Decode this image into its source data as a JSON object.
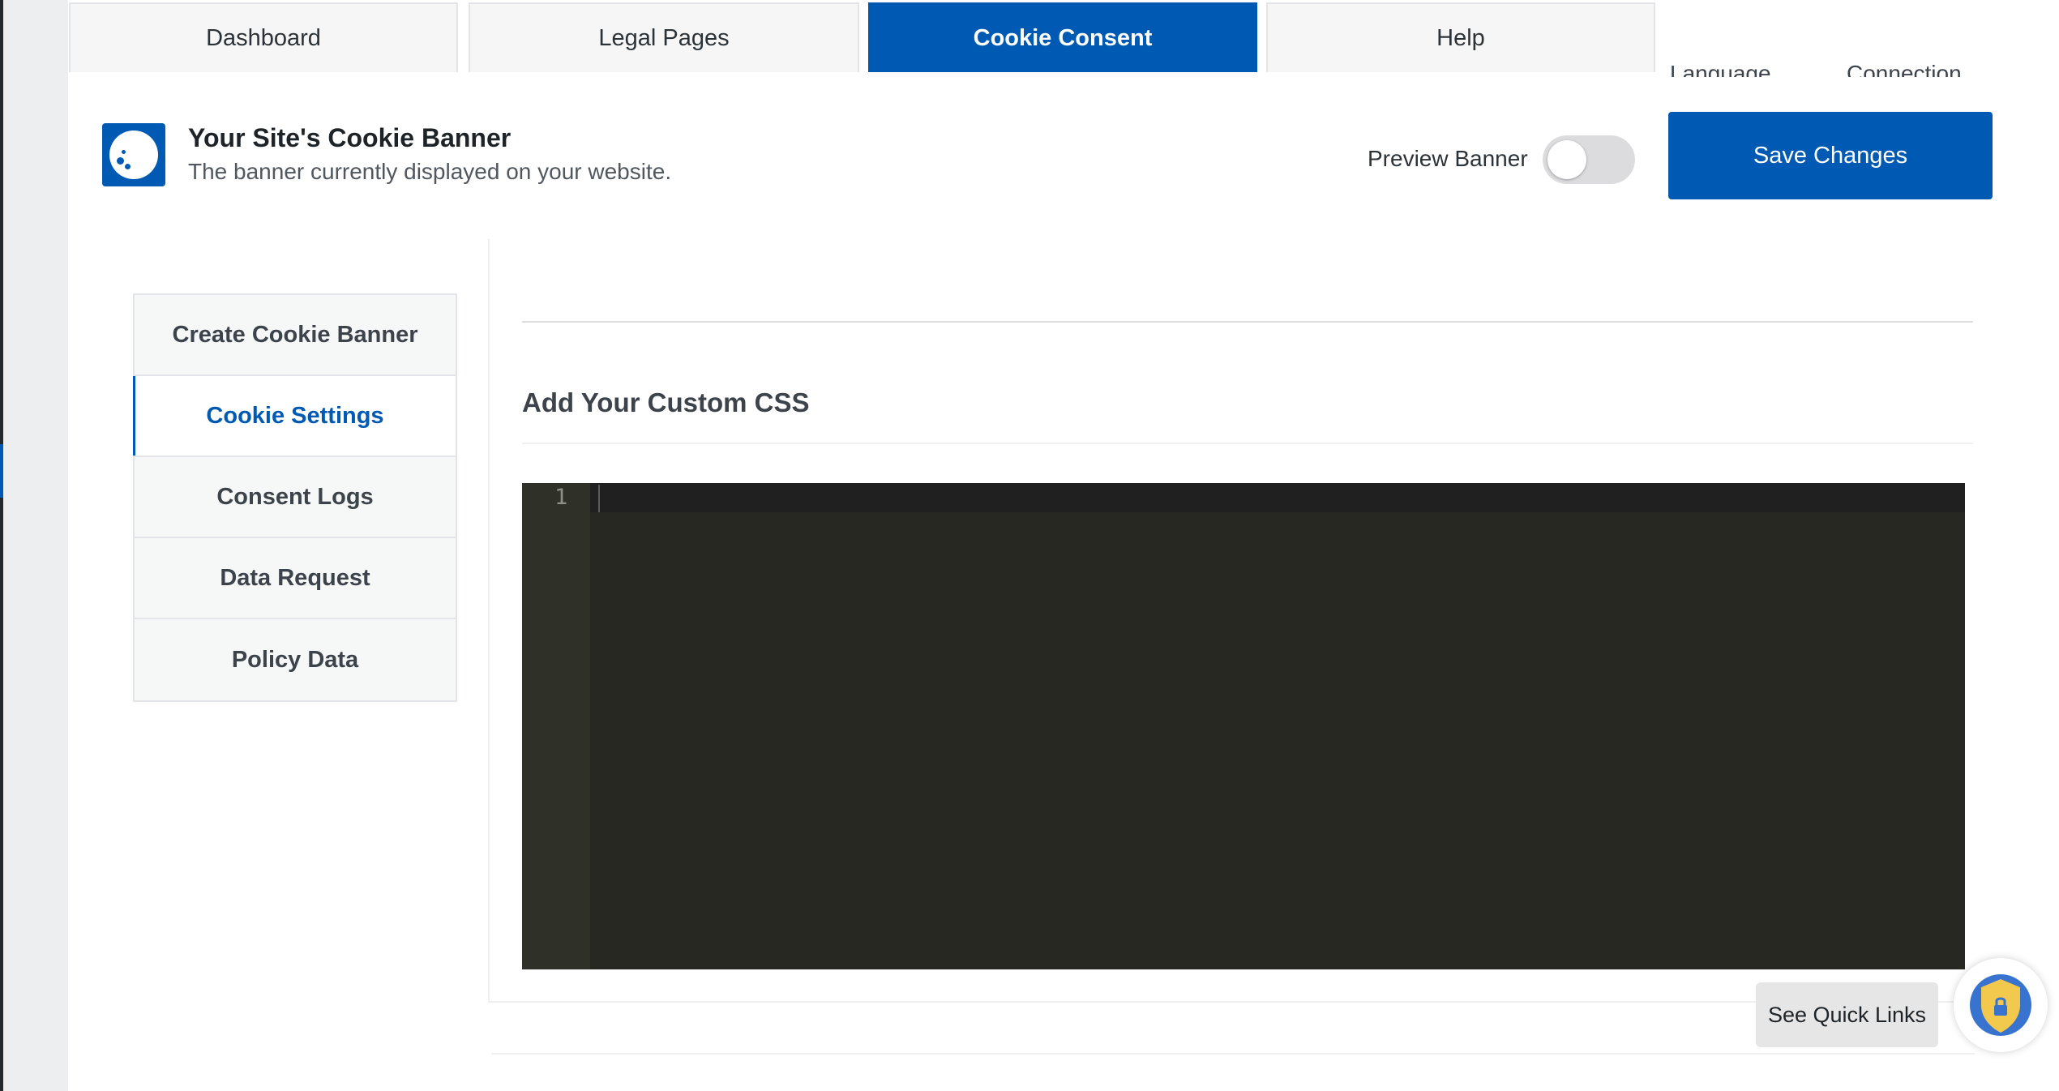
{
  "tabs": [
    {
      "label": "Dashboard",
      "active": false
    },
    {
      "label": "Legal Pages",
      "active": false
    },
    {
      "label": "Cookie Consent",
      "active": true
    },
    {
      "label": "Help",
      "active": false
    }
  ],
  "sub_tabs_partial": [
    "Language",
    "Connection"
  ],
  "banner": {
    "title": "Your Site's Cookie Banner",
    "subtitle": "The banner currently displayed on your website.",
    "preview_label": "Preview Banner",
    "preview_enabled": false,
    "save_label": "Save Changes"
  },
  "side_nav": [
    {
      "label": "Create Cookie Banner",
      "active": false
    },
    {
      "label": "Cookie Settings",
      "active": true
    },
    {
      "label": "Consent Logs",
      "active": false
    },
    {
      "label": "Data Request",
      "active": false
    },
    {
      "label": "Policy Data",
      "active": false
    }
  ],
  "main": {
    "heading": "Add Your Custom CSS",
    "editor": {
      "line_numbers": [
        "1"
      ],
      "content": ""
    }
  },
  "quick_links_label": "See Quick Links",
  "icons": {
    "logo": "cookie-logo-icon",
    "fab": "shield-lock-icon"
  },
  "colors": {
    "accent": "#0059b3",
    "editor_bg": "#272822",
    "fab_shield": "#f2c94c"
  }
}
